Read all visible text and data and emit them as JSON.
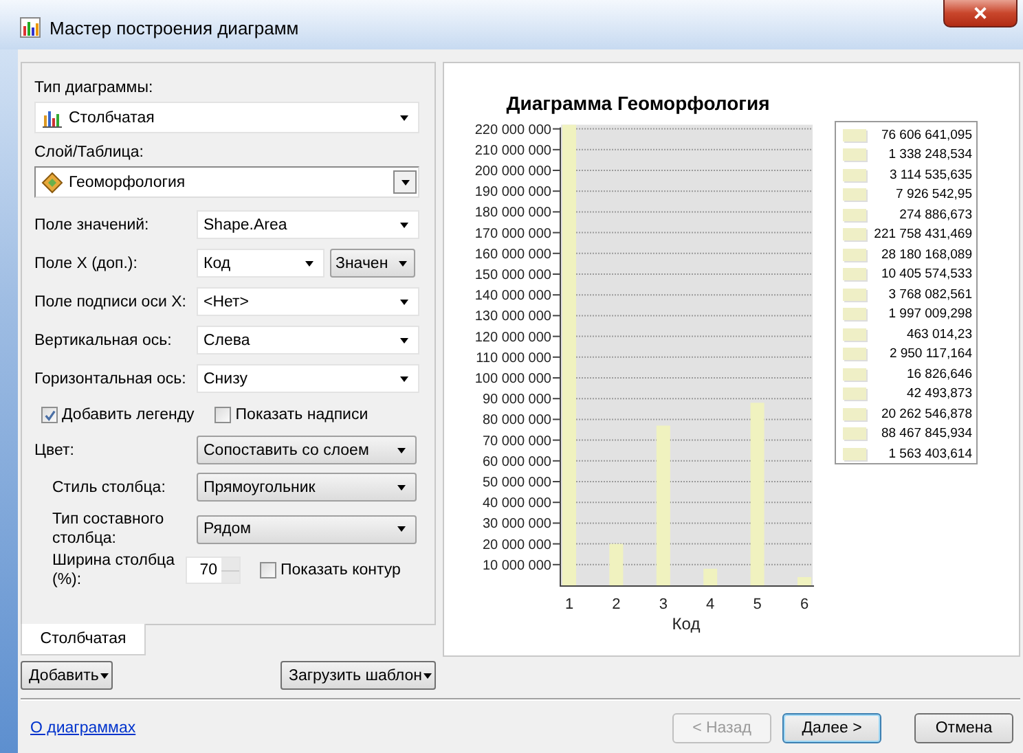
{
  "window": {
    "title": "Мастер построения диаграмм"
  },
  "chart_type": {
    "label": "Тип диаграммы:",
    "value": "Столбчатая"
  },
  "layer": {
    "label": "Слой/Таблица:",
    "value": "Геоморфология"
  },
  "fields": [
    {
      "label": "Поле значений:",
      "value": "Shape.Area"
    },
    {
      "label": "Поле X (доп.):",
      "value": "Код",
      "extra": "Значен"
    },
    {
      "label": "Поле подписи оси X:",
      "value": "<Нет>"
    },
    {
      "label": "Вертикальная ось:",
      "value": "Слева"
    },
    {
      "label": "Горизонтальная ось:",
      "value": "Снизу"
    }
  ],
  "options": [
    {
      "label": "Добавить легенду",
      "checked": true
    },
    {
      "label": "Показать надписи",
      "checked": false
    }
  ],
  "style_fields": [
    {
      "label": "Цвет:",
      "value": "Сопоставить со слоем",
      "indent": false
    },
    {
      "label": "Стиль столбца:",
      "value": "Прямоугольник",
      "indent": true
    },
    {
      "label": "Тип составного столбца:",
      "value": "Рядом",
      "indent": true
    }
  ],
  "bar_width": {
    "label": "Ширина столбца (%):",
    "value": "70"
  },
  "outline": {
    "label": "Показать контур",
    "checked": false
  },
  "tabs": [
    {
      "label": "Столбчатая",
      "selected": true
    }
  ],
  "panel_buttons": [
    "Добавить",
    "Загрузить шаблон"
  ],
  "link": "О диаграммах",
  "chart": {
    "chart_data": {
      "type": "bar",
      "title": "Диаграмма  Геоморфология",
      "xlabel": "Код",
      "categories": [
        "1",
        "2",
        "3",
        "4",
        "5",
        "6"
      ],
      "values": [
        222000000,
        20000000,
        77000000,
        8000000,
        88000000,
        4000000
      ],
      "ylim": [
        0,
        222000000
      ],
      "grid": true,
      "yticks": [
        {
          "value": 10000000,
          "label": "10 000 000"
        },
        {
          "value": 20000000,
          "label": "20 000 000"
        },
        {
          "value": 30000000,
          "label": "30 000 000"
        },
        {
          "value": 40000000,
          "label": "40 000 000"
        },
        {
          "value": 50000000,
          "label": "50 000 000"
        },
        {
          "value": 60000000,
          "label": "60 000 000"
        },
        {
          "value": 70000000,
          "label": "70 000 000"
        },
        {
          "value": 80000000,
          "label": "80 000 000"
        },
        {
          "value": 90000000,
          "label": "90 000 000"
        },
        {
          "value": 100000000,
          "label": "100 000 000"
        },
        {
          "value": 110000000,
          "label": "110 000 000"
        },
        {
          "value": 120000000,
          "label": "120 000 000"
        },
        {
          "value": 130000000,
          "label": "130 000 000"
        },
        {
          "value": 140000000,
          "label": "140 000 000"
        },
        {
          "value": 150000000,
          "label": "150 000 000"
        },
        {
          "value": 160000000,
          "label": "160 000 000"
        },
        {
          "value": 170000000,
          "label": "170 000 000"
        },
        {
          "value": 180000000,
          "label": "180 000 000"
        },
        {
          "value": 190000000,
          "label": "190 000 000"
        },
        {
          "value": 200000000,
          "label": "200 000 000"
        },
        {
          "value": 210000000,
          "label": "210 000 000"
        },
        {
          "value": 220000000,
          "label": "220 000 000"
        }
      ]
    },
    "legend": [
      "76 606 641,095",
      "1 338 248,534",
      "3 114 535,635",
      "7 926 542,95",
      "274 886,673",
      "221 758 431,469",
      "28 180 168,089",
      "10 405 574,533",
      "3 768 082,561",
      "1 997 009,298",
      "463 014,23",
      "2 950 117,164",
      "16 826,646",
      "42 493,873",
      "20 262 546,878",
      "88 467 845,934",
      "1 563 403,614"
    ]
  },
  "nav_buttons": [
    {
      "label": "< Назад",
      "disabled": true,
      "default": false
    },
    {
      "label": "Далее >",
      "disabled": false,
      "default": true
    },
    {
      "label": "Отмена",
      "disabled": false,
      "default": false
    }
  ]
}
